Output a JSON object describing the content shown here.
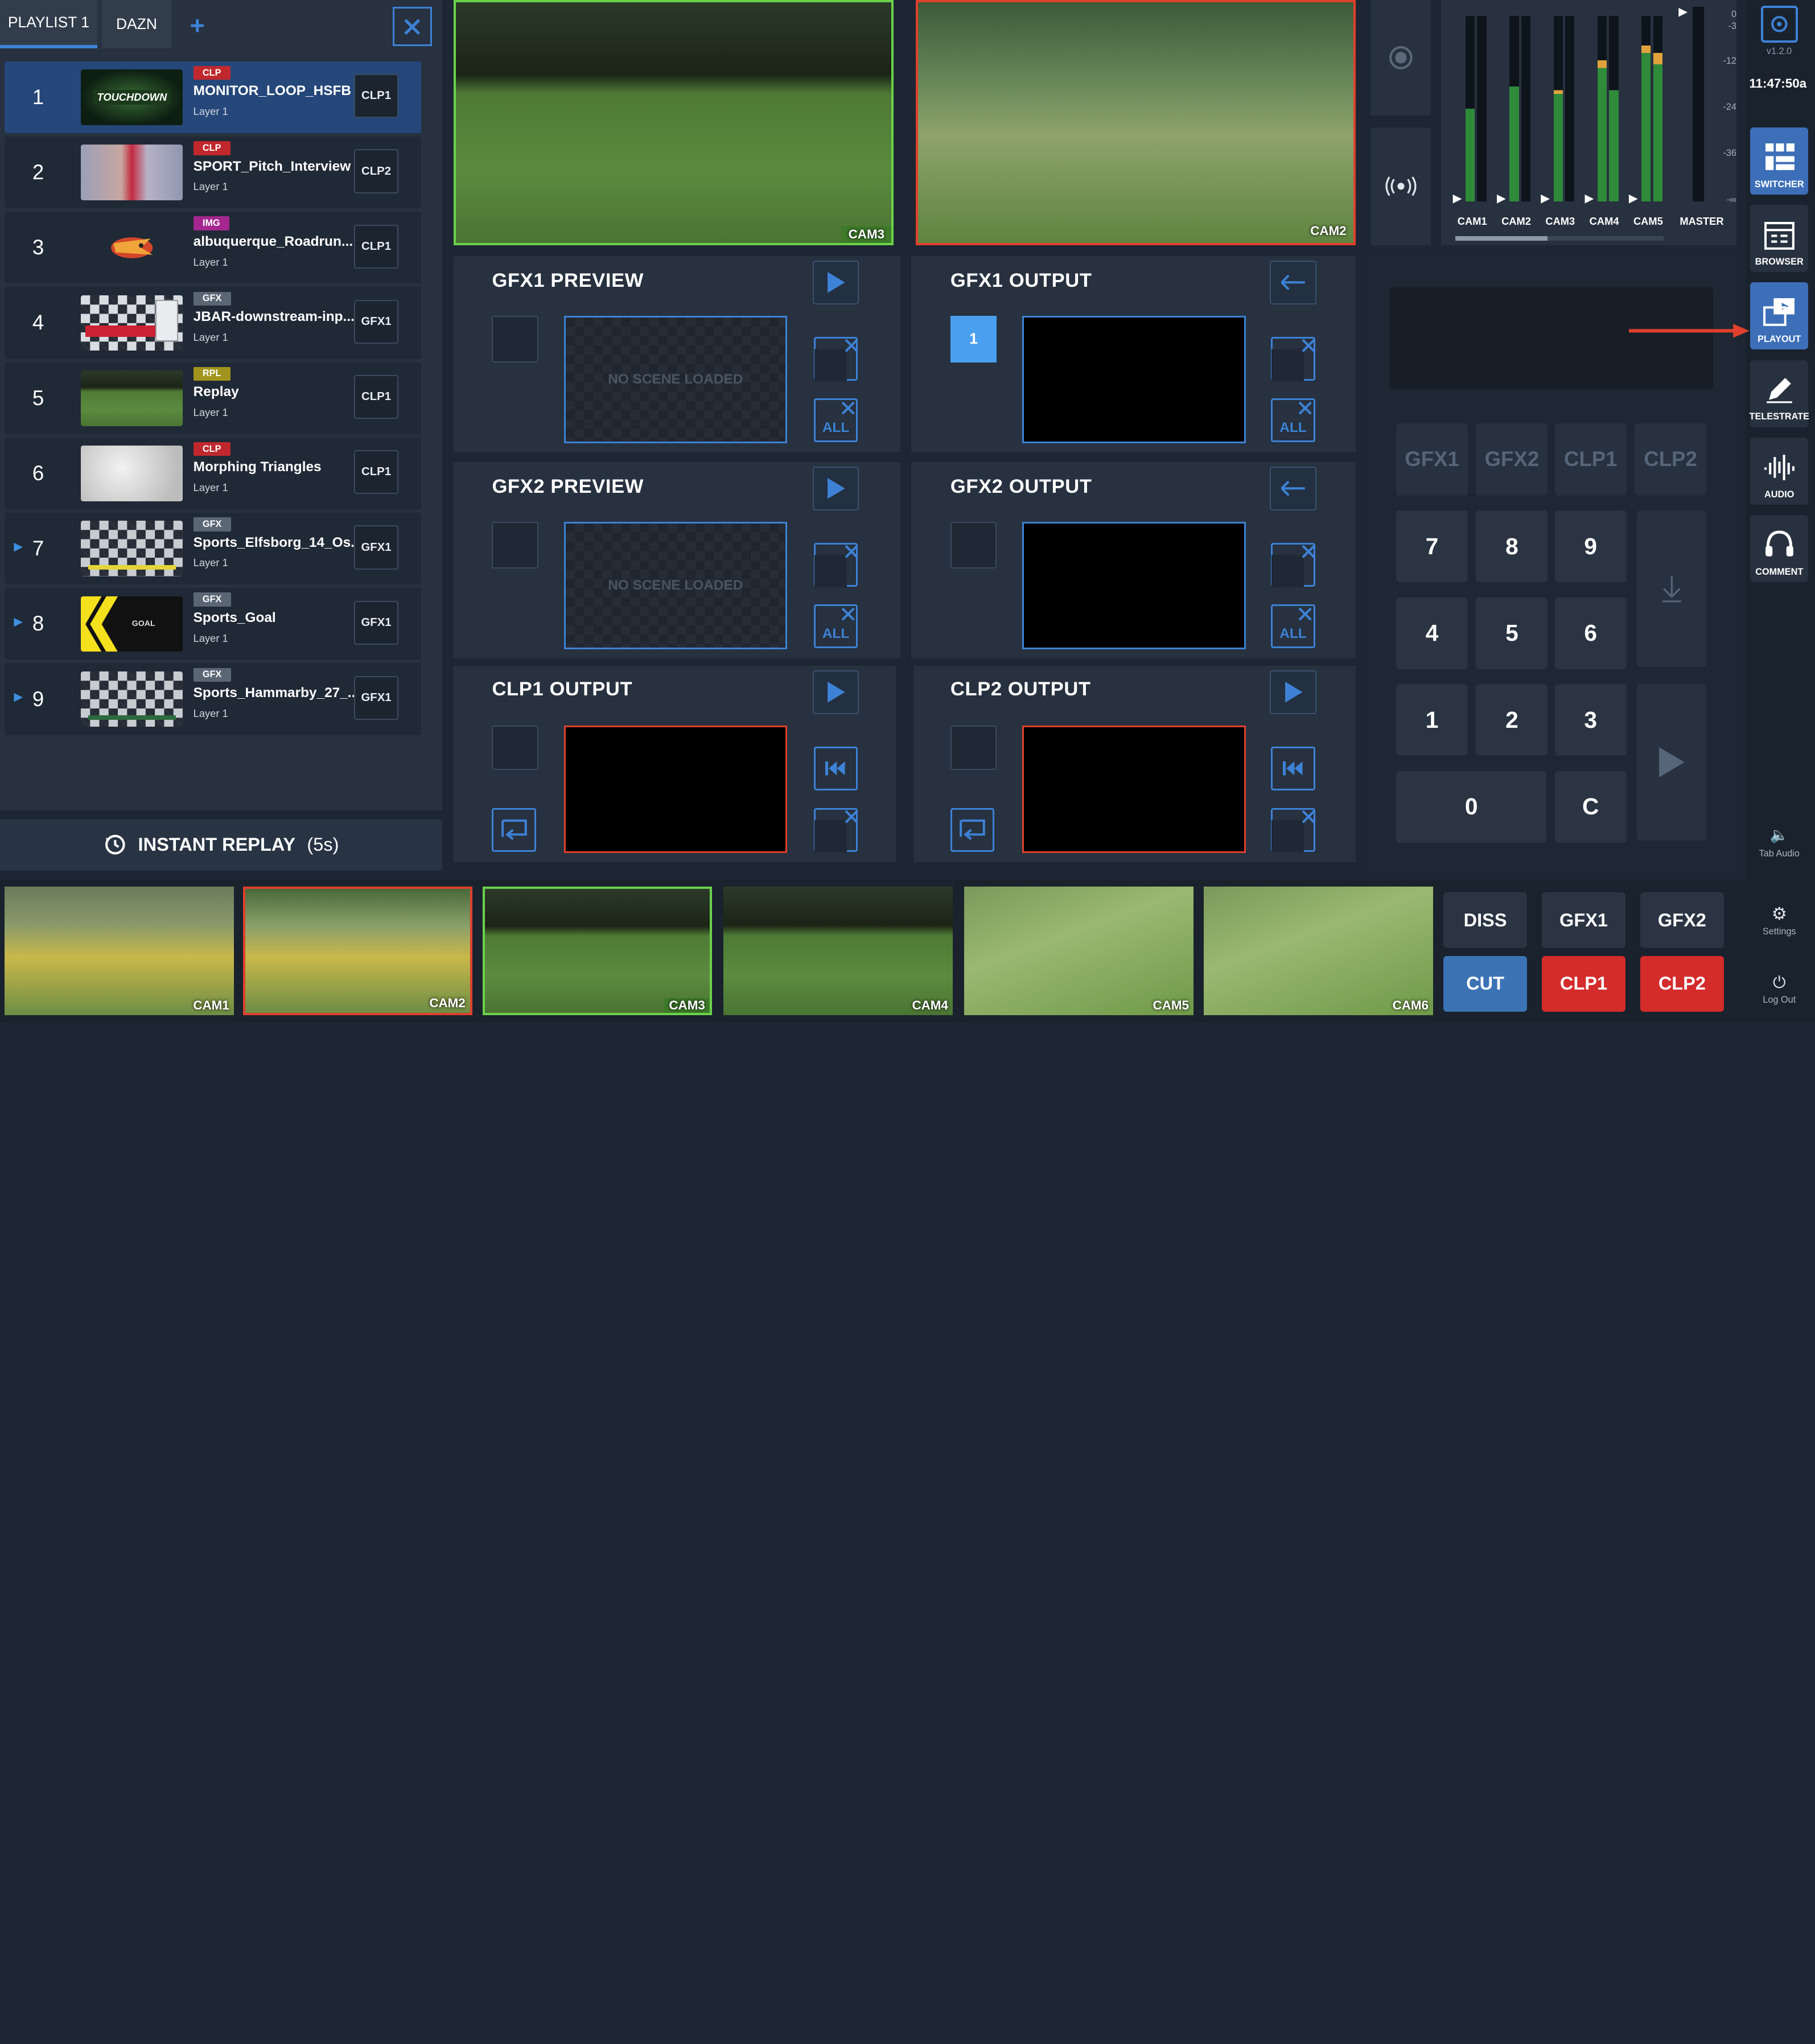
{
  "playlist": {
    "tabs": [
      "PLAYLIST 1",
      "DAZN"
    ],
    "items": [
      {
        "num": "1",
        "type": "CLP",
        "title": "MONITOR_LOOP_HSFB",
        "layer": "Layer 1",
        "target": "CLP1",
        "thumb_text": "TOUCHDOWN"
      },
      {
        "num": "2",
        "type": "CLP",
        "title": "SPORT_Pitch_Interview",
        "layer": "Layer 1",
        "target": "CLP2"
      },
      {
        "num": "3",
        "type": "IMG",
        "title": "albuquerque_Roadrun...",
        "layer": "Layer 1",
        "target": "CLP1"
      },
      {
        "num": "4",
        "type": "GFX",
        "title": "JBAR-downstream-inp...",
        "layer": "Layer 1",
        "target": "GFX1"
      },
      {
        "num": "5",
        "type": "RPL",
        "title": "Replay",
        "layer": "Layer 1",
        "target": "CLP1"
      },
      {
        "num": "6",
        "type": "CLP",
        "title": "Morphing Triangles",
        "layer": "Layer 1",
        "target": "CLP1"
      },
      {
        "num": "7",
        "type": "GFX",
        "title": "Sports_Elfsborg_14_Os...",
        "layer": "Layer 1",
        "target": "GFX1"
      },
      {
        "num": "8",
        "type": "GFX",
        "title": "Sports_Goal",
        "layer": "Layer 1",
        "target": "GFX1",
        "thumb_text": "GOAL"
      },
      {
        "num": "9",
        "type": "GFX",
        "title": "Sports_Hammarby_27_...",
        "layer": "Layer 1",
        "target": "GFX1"
      }
    ],
    "instant_replay": "INSTANT REPLAY",
    "instant_replay_duration": "(5s)"
  },
  "monitors": {
    "preview": "CAM3",
    "program": "CAM2"
  },
  "gfx": {
    "gfx1_preview": "GFX1 PREVIEW",
    "gfx1_output": "GFX1 OUTPUT",
    "gfx2_preview": "GFX2 PREVIEW",
    "gfx2_output": "GFX2 OUTPUT",
    "clp1_output": "CLP1 OUTPUT",
    "clp2_output": "CLP2 OUTPUT",
    "no_scene": "NO SCENE LOADED",
    "all_label": "ALL",
    "gfx1_output_layer": "1"
  },
  "audio": {
    "channels": [
      "CAM1",
      "CAM2",
      "CAM3",
      "CAM4",
      "CAM5"
    ],
    "master": "MASTER",
    "scale": [
      "0",
      "-3",
      "-12",
      "-24",
      "-36",
      "-∞"
    ]
  },
  "keypad": {
    "sources": [
      "GFX1",
      "GFX2",
      "CLP1",
      "CLP2"
    ],
    "keys": [
      "7",
      "8",
      "9",
      "4",
      "5",
      "6",
      "1",
      "2",
      "3"
    ],
    "zero": "0",
    "clear": "C"
  },
  "bottom": {
    "cams": [
      "CAM1",
      "CAM2",
      "CAM3",
      "CAM4",
      "CAM5",
      "CAM6"
    ],
    "transitions": [
      "DISS",
      "GFX1",
      "GFX2",
      "CUT",
      "CLP1",
      "CLP2"
    ]
  },
  "sidebar": {
    "version": "v1.2.0",
    "time": "11:47:50a",
    "items": [
      "SWITCHER",
      "BROWSER",
      "PLAYOUT",
      "TELESTRATE",
      "AUDIO",
      "COMMENT"
    ],
    "tab_audio": "Tab Audio",
    "settings": "Settings",
    "logout": "Log Out"
  },
  "colors": {
    "accent": "#3d82d6",
    "clp_badge": "#c0282d",
    "img_badge": "#a5268f",
    "gfx_badge": "#5b6675",
    "rpl_badge": "#a0941c",
    "preview_border": "#6bd24a",
    "program_border": "#e0402c",
    "active_red": "#d42b2b"
  }
}
